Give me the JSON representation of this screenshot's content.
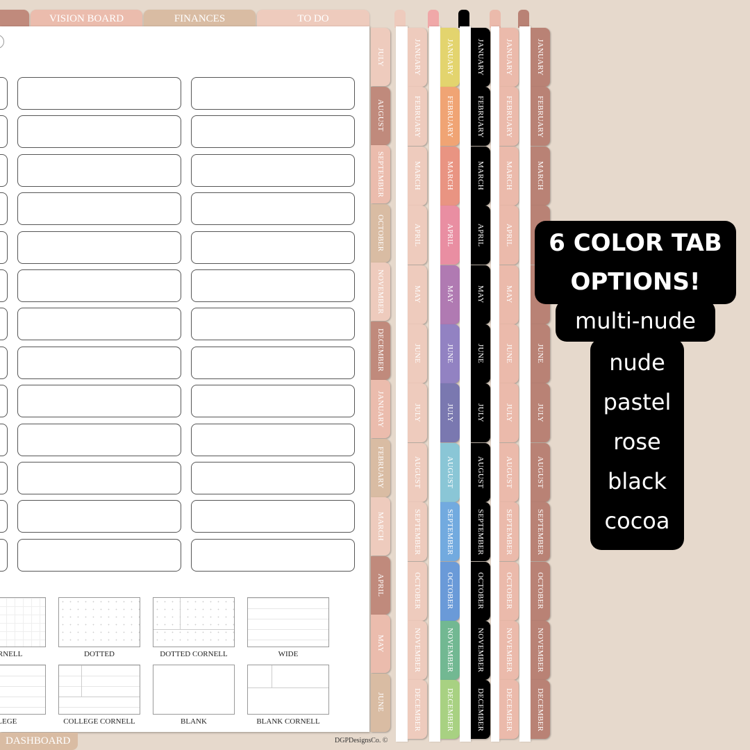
{
  "top_tabs": [
    {
      "label": "",
      "color": "#c08a7c"
    },
    {
      "label": "VISION BOARD",
      "color": "#ebbcad"
    },
    {
      "label": "FINANCES",
      "color": "#d9bca3"
    },
    {
      "label": "TO DO",
      "color": "#eecbbd"
    }
  ],
  "main_tabs": {
    "labels": [
      "JULY",
      "AUGUST",
      "SEPTEMBER",
      "OCTOBER",
      "NOVEMBER",
      "DECEMBER",
      "JANUARY",
      "FEBRUARY",
      "MARCH",
      "APRIL",
      "MAY",
      "JUNE"
    ],
    "colors": [
      "#eecbbd",
      "#c08a7c",
      "#ebbcad",
      "#d9bca3"
    ]
  },
  "templates": [
    "CORNELL",
    "DOTTED",
    "DOTTED CORNELL",
    "WIDE",
    "LLEGE",
    "COLLEGE CORNELL",
    "BLANK",
    "BLANK CORNELL"
  ],
  "dashboard_label": "DASHBOARD",
  "copyright": "DGPDesignsCo. ©",
  "months": [
    "JANUARY",
    "FEBRUARY",
    "MARCH",
    "APRIL",
    "MAY",
    "JUNE",
    "JULY",
    "AUGUST",
    "SEPTEMBER",
    "OCTOBER",
    "NOVEMBER",
    "DECEMBER"
  ],
  "tab_sets": [
    {
      "name": "nude",
      "colors": [
        "#eecbbd"
      ]
    },
    {
      "name": "pastel",
      "colors": [
        "#e3d46e",
        "#f0a474",
        "#e99482",
        "#e98ea2",
        "#b07ab2",
        "#9282c2",
        "#7a78b0",
        "#8ac6d6",
        "#72aadf",
        "#6a9ad8",
        "#72b892",
        "#a8d182"
      ]
    },
    {
      "name": "black",
      "colors": [
        "#000000"
      ]
    },
    {
      "name": "rose",
      "colors": [
        "#ebbaab"
      ]
    },
    {
      "name": "cocoa",
      "colors": [
        "#b98275"
      ]
    }
  ],
  "badge": {
    "title1": "6 COLOR TAB",
    "title2": "OPTIONS!",
    "options": [
      "multi-nude",
      "nude",
      "pastel",
      "rose",
      "black",
      "cocoa"
    ]
  }
}
